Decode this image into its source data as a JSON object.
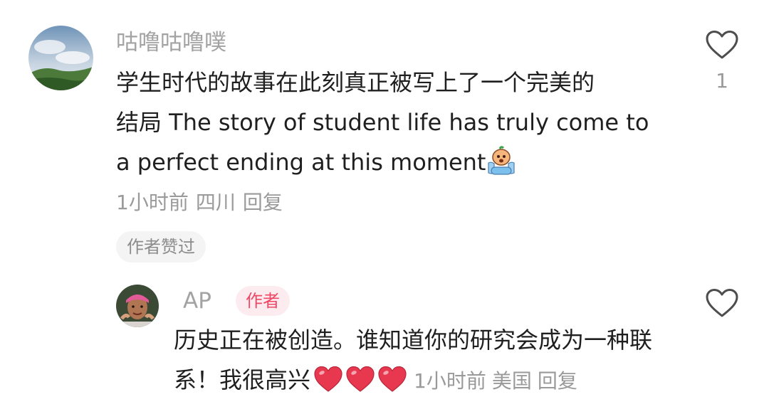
{
  "comment": {
    "username": "咕噜咕噜噗",
    "text_line1": "学生时代的故事在此刻真正被写上了一个完美的",
    "text_line2": "结局  The story of student life has truly come to",
    "text_line3": "a perfect ending at this moment",
    "emoji_icon": "crying-face-emoji-icon",
    "time": "1小时前",
    "location": "四川",
    "reply_label": "回复",
    "author_liked_label": "作者赞过",
    "like_count": "1"
  },
  "reply": {
    "username": "AP",
    "author_badge": "作者",
    "text": "历史正在被创造。谁知道你的研究会成为一种联系！我很高兴",
    "emoji_icons": [
      "red-heart-icon",
      "red-heart-icon",
      "red-heart-icon"
    ],
    "time": "1小时前",
    "location": "美国",
    "reply_label": "回复"
  },
  "colors": {
    "text_primary": "#1f1f1f",
    "text_secondary": "#9a9a9a",
    "author_badge_text": "#ef4867",
    "author_badge_bg": "#fdecef",
    "heart": "#e8384f"
  }
}
